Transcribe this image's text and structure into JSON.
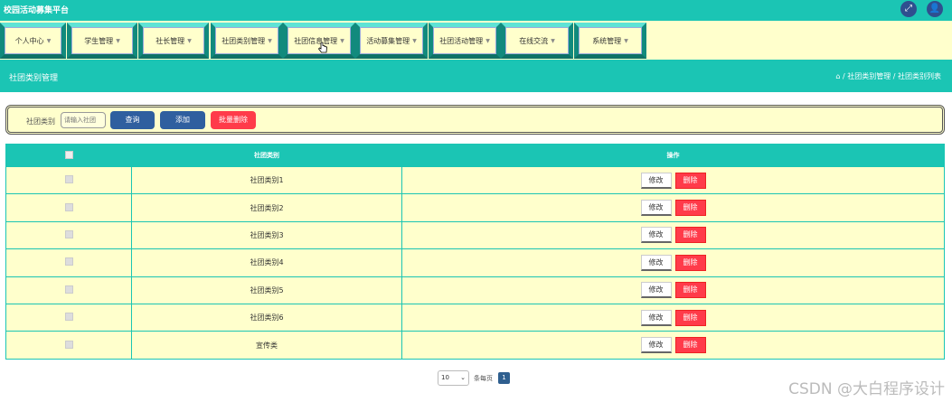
{
  "app": {
    "title": "校园活动募集平台"
  },
  "top_icons": [
    "fullscreen-icon",
    "user-icon"
  ],
  "nav": [
    {
      "label": "个人中心"
    },
    {
      "label": "学生管理"
    },
    {
      "label": "社长管理"
    },
    {
      "label": "社团类别管理"
    },
    {
      "label": "社团信息管理"
    },
    {
      "label": "活动募集管理"
    },
    {
      "label": "社团活动管理"
    },
    {
      "label": "在线交流"
    },
    {
      "label": "系统管理"
    }
  ],
  "page": {
    "title": "社团类别管理"
  },
  "breadcrumb": {
    "text": "⌂ / 社团类别管理 / 社团类别列表"
  },
  "search": {
    "label": "社团类别",
    "placeholder": "请输入社团",
    "query_btn": "查询",
    "add_btn": "添加",
    "batch_delete_btn": "批量删除"
  },
  "table": {
    "headers": [
      "社团类别",
      "操作"
    ],
    "rows": [
      "社团类别1",
      "社团类别2",
      "社团类别3",
      "社团类别4",
      "社团类别5",
      "社团类别6",
      "宣传类"
    ],
    "edit_label": "修改",
    "delete_label": "删除"
  },
  "pagination": {
    "page_size": "10",
    "per_page_label": "条每页",
    "current_page": "1"
  },
  "watermark": "CSDN @大白程序设计",
  "colors": {
    "primary": "#1bc5b4",
    "panel_bg": "#ffffcc",
    "btn_blue": "#2f5f9f",
    "btn_red": "#ff3b4a"
  }
}
